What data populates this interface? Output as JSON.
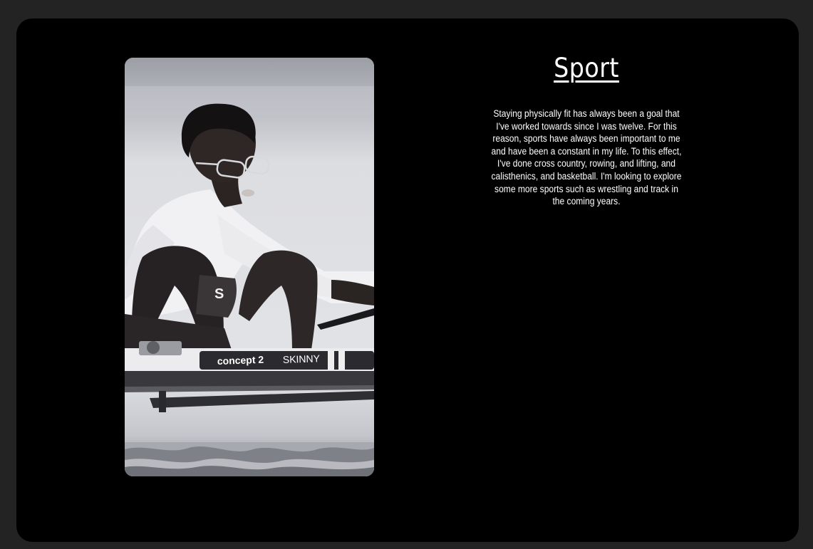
{
  "section": {
    "title": "Sport",
    "body": "Staying physically fit has always been a goal that I've worked towards since I was twelve. For this reason, sports have always been important to me and have been a constant in my life. To this effect, I've done cross country, rowing, and lifting, and calisthenics, and basketball. I'm looking to explore some more sports such as wrestling and track in the coming years."
  },
  "photo": {
    "oar_brand": "concept 2",
    "oar_model": "SKINNY",
    "jersey_letter": "S"
  },
  "colors": {
    "page_background": "#232323",
    "card_background": "#000000",
    "text": "#ffffff"
  }
}
